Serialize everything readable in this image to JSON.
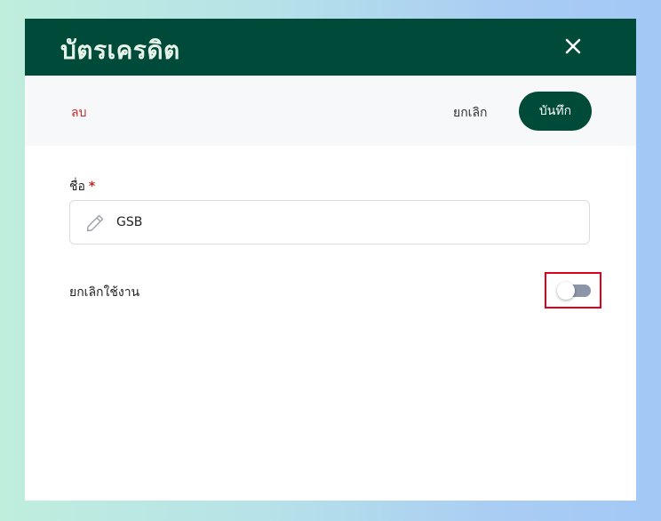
{
  "dialog": {
    "title": "บัตรเครดิต",
    "close_icon": "close-icon"
  },
  "toolbar": {
    "delete_label": "ลบ",
    "cancel_label": "ยกเลิก",
    "save_label": "บันทึก"
  },
  "form": {
    "name_label": "ชื่อ",
    "required_mark": "*",
    "name_value": "GSB",
    "name_icon": "pencil-icon",
    "disable_label": "ยกเลิกใช้งาน",
    "disable_toggle_on": false
  },
  "colors": {
    "header_bg": "#004a3a",
    "accent": "#004a3a",
    "danger": "#c62828",
    "highlight": "#e0001b",
    "toggle_off": "#8c96a8"
  }
}
